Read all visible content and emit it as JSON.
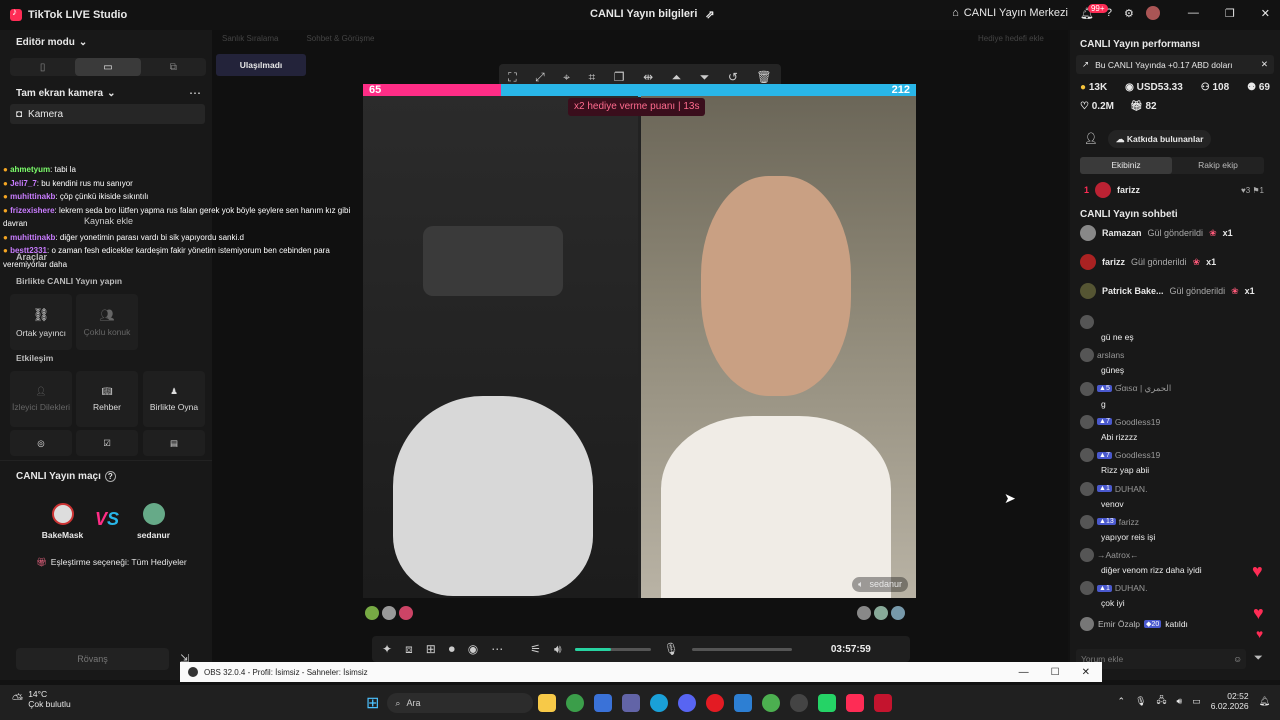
{
  "app": {
    "title": "TikTok LIVE Studio",
    "center_title": "CANLI Yayın bilgileri",
    "live_center": "CANLI Yayın Merkezi",
    "notif_badge": "99+"
  },
  "left": {
    "editor_mode": "Editör modu",
    "scene": "Tam ekran kamera",
    "camera": "Kamera",
    "source_add": "Kaynak ekle",
    "tools": "Araçlar",
    "collab_title": "Birlikte CANLI Yayın yapın",
    "co_host": "Ortak yayıncı",
    "multi_guest": "Çoklu konuk",
    "interaction": "Etkileşim",
    "viewer_requests": "İzleyici Dilekleri",
    "guide": "Rehber",
    "play_together": "Birlikte Oyna",
    "match_title": "CANLI Yayın maçı",
    "player1": "BakeMask",
    "player2": "sedanur",
    "match_option": "Eşleştirme seçeneği: Tüm Hediyeler",
    "rematch": "Rövanş"
  },
  "chat_overlay": [
    {
      "user": "ahmetyum",
      "text": ": tabi la",
      "color": "#7cff6b"
    },
    {
      "user": "Jeli7_7",
      "text": ": bu kendini rus mu sanıyor",
      "color": "#c97cff"
    },
    {
      "user": "muhittinakb",
      "text": ": çöp çünkü ikiside sıkıntılı",
      "color": "#c97cff"
    },
    {
      "user": "frizexishere",
      "text": ": lekrem seda bro lütfen yapma rus falan gerek yok böyle şeylere sen hanım kız gibi davran",
      "color": "#c97cff"
    },
    {
      "user": "muhittinakb",
      "text": ": diğer yonetimin parası vardı bi sik yapıyordu sanki.d",
      "color": "#c97cff"
    },
    {
      "user": "bestt2331",
      "text": ": o zaman fesh edicekler kardeşim fakir yönetim istemiyorum ben cebinden para veremiyorlar daha",
      "color": "#c97cff"
    }
  ],
  "stage": {
    "top_left": "Sanlık Sıralama",
    "top_mid": "Sohbet & Görüşme",
    "top_right": "Hediye hedefi ekle",
    "unreached": "Ulaşılmadı",
    "score_left": "65",
    "score_right": "212",
    "x2_text": "x2 hediye verme puanı",
    "x2_time": "13s",
    "opponent_name": "sedanur",
    "timer": "03:57:59"
  },
  "right": {
    "perf_title": "CANLI Yayın performansı",
    "banner": "Bu CANLI Yayında +0.17 ABD doları",
    "likes": "13K",
    "usd": "USD53.33",
    "viewers": "108",
    "gifters": "69",
    "hearts": "0.2M",
    "gifts": "82",
    "contributors": "Katkıda bulunanlar",
    "tab_mine": "Ekibiniz",
    "tab_rival": "Rakip ekip",
    "rank_user": "farizz",
    "rank_num": "1",
    "rank_a": "3",
    "rank_b": "1",
    "chat_title": "CANLI Yayın sohbeti",
    "comment_placeholder": "Yorum ekle"
  },
  "gifts": [
    {
      "user": "Ramazan",
      "text": "Gül gönderildi",
      "count": "x1"
    },
    {
      "user": "farizz",
      "text": "Gül gönderildi",
      "count": "x1"
    },
    {
      "user": "Patrick Bake...",
      "text": "Gül gönderildi",
      "count": "x1"
    }
  ],
  "messages": [
    {
      "user": "",
      "text": "gü ne eş",
      "level": ""
    },
    {
      "user": "arslans",
      "text": "güneş",
      "level": ""
    },
    {
      "user": "Ɠαɩꜱα | الحمري",
      "text": "g",
      "level": "5"
    },
    {
      "user": "Goodless19",
      "text": "Abi rizzzz",
      "level": "7"
    },
    {
      "user": "Goodless19",
      "text": "Rizz yap abii",
      "level": "7"
    },
    {
      "user": "DUHAN.",
      "text": "venov",
      "level": "1"
    },
    {
      "user": "farizz",
      "text": "yapıyor reis işi",
      "level": "13"
    },
    {
      "user": "→Aatrox←",
      "text": "diğer venom rizz daha iyidi",
      "level": ""
    },
    {
      "user": "DUHAN.",
      "text": "çok iyi",
      "level": "1"
    }
  ],
  "join": {
    "user": "Emir Özalp",
    "level": "20",
    "text": "katıldı"
  },
  "obs": {
    "title": "OBS 32.0.4 - Profil: İsimsiz - Sahneler: İsimsiz"
  },
  "taskbar": {
    "temp": "14°C",
    "weather": "Çok bulutlu",
    "search": "Ara",
    "time": "02:52",
    "date": "6.02.2026"
  },
  "colors": {
    "accent": "#fe2c55",
    "teal": "#27d3a1",
    "blue": "#29b6e8"
  }
}
